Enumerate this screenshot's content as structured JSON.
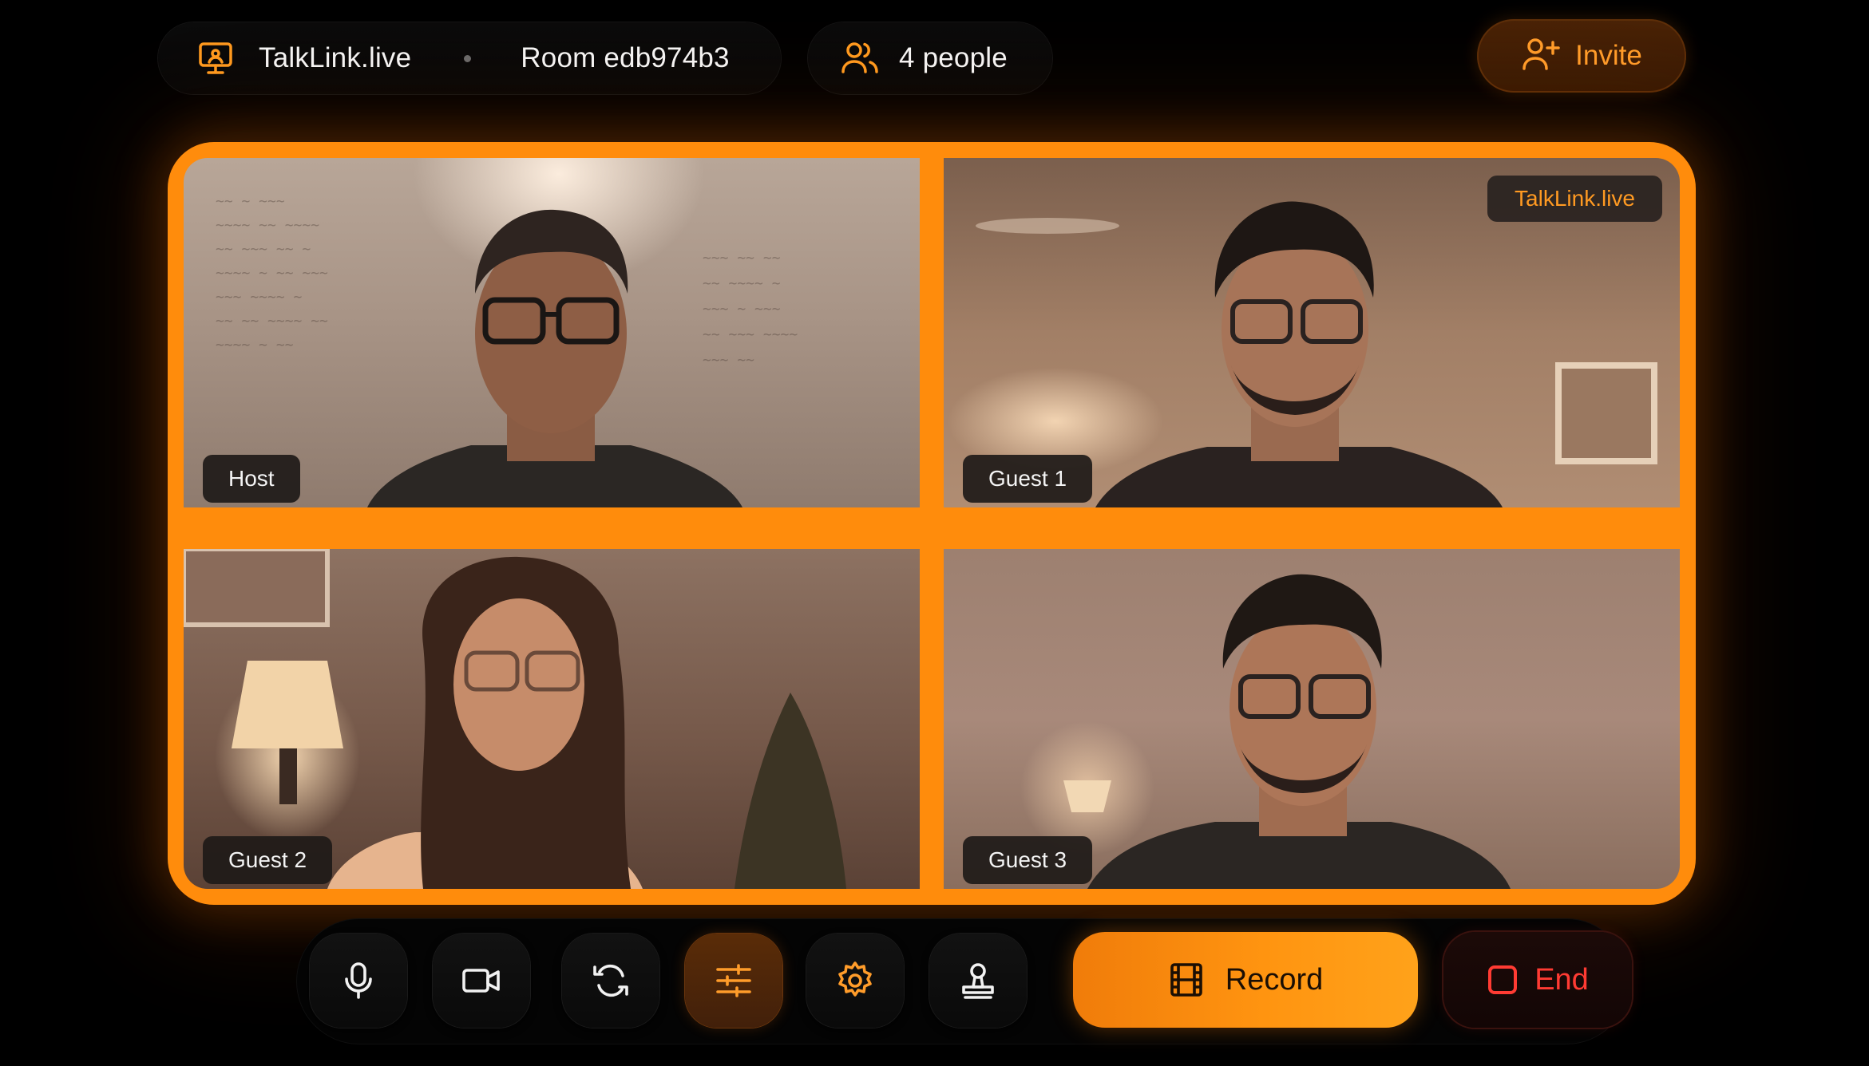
{
  "app": {
    "brand_name": "TalkLink.live",
    "room_label": "Room edb974b3",
    "people_count": "4 people",
    "invite_label": "Invite"
  },
  "watermark": "TalkLink.live",
  "participants": [
    {
      "label": "Host"
    },
    {
      "label": "Guest 1"
    },
    {
      "label": "Guest 2"
    },
    {
      "label": "Guest 3"
    }
  ],
  "controls": {
    "buttons": [
      {
        "icon": "microphone-icon",
        "active": false
      },
      {
        "icon": "camera-icon",
        "active": false
      },
      {
        "icon": "switch-camera-icon",
        "active": false
      },
      {
        "icon": "sliders-icon",
        "active": true
      },
      {
        "icon": "gear-icon",
        "active": false
      },
      {
        "icon": "stamp-icon",
        "active": false
      }
    ],
    "record_label": "Record",
    "end_label": "End"
  },
  "colors": {
    "accent": "#ff8c0c",
    "end": "#ff3b33",
    "background": "#000000"
  }
}
